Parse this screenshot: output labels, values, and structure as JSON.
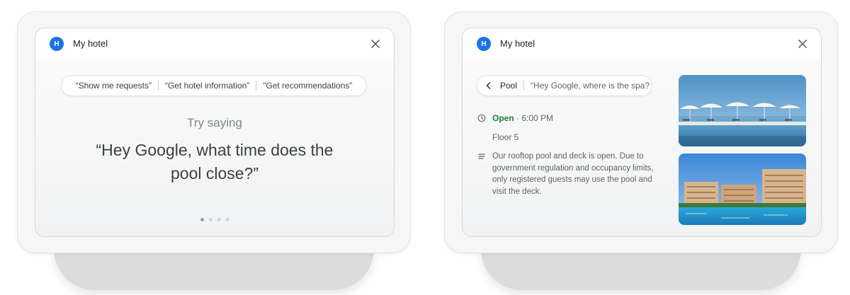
{
  "left_device": {
    "header": {
      "avatar_letter": "H",
      "title": "My hotel"
    },
    "suggestions": [
      "“Show me requests”",
      "“Get hotel information”",
      "“Get recommendations”"
    ],
    "prompt": "Try saying",
    "quote_line1": "“Hey Google, what time does the",
    "quote_line2": "pool close?”",
    "pagination": {
      "total": 4,
      "active": 1
    }
  },
  "right_device": {
    "header": {
      "avatar_letter": "H",
      "title": "My hotel"
    },
    "breadcrumb": {
      "label": "Pool",
      "hint": "“Hey Google, where is the spa?"
    },
    "status": {
      "open_label": "Open",
      "separator": " · ",
      "time": "6:00 PM"
    },
    "floor": "Floor 5",
    "description": "Our rooftop pool and deck is open. Due to government regulation and occupancy limits, only registered guests may use the pool and visit the deck.",
    "images": [
      "rooftop-pool-photo",
      "resort-pool-photo"
    ]
  },
  "colors": {
    "accent": "#1a73e8",
    "open": "#188038"
  },
  "icons": [
    "close-icon",
    "chevron-left-icon",
    "clock-icon",
    "notes-icon"
  ]
}
